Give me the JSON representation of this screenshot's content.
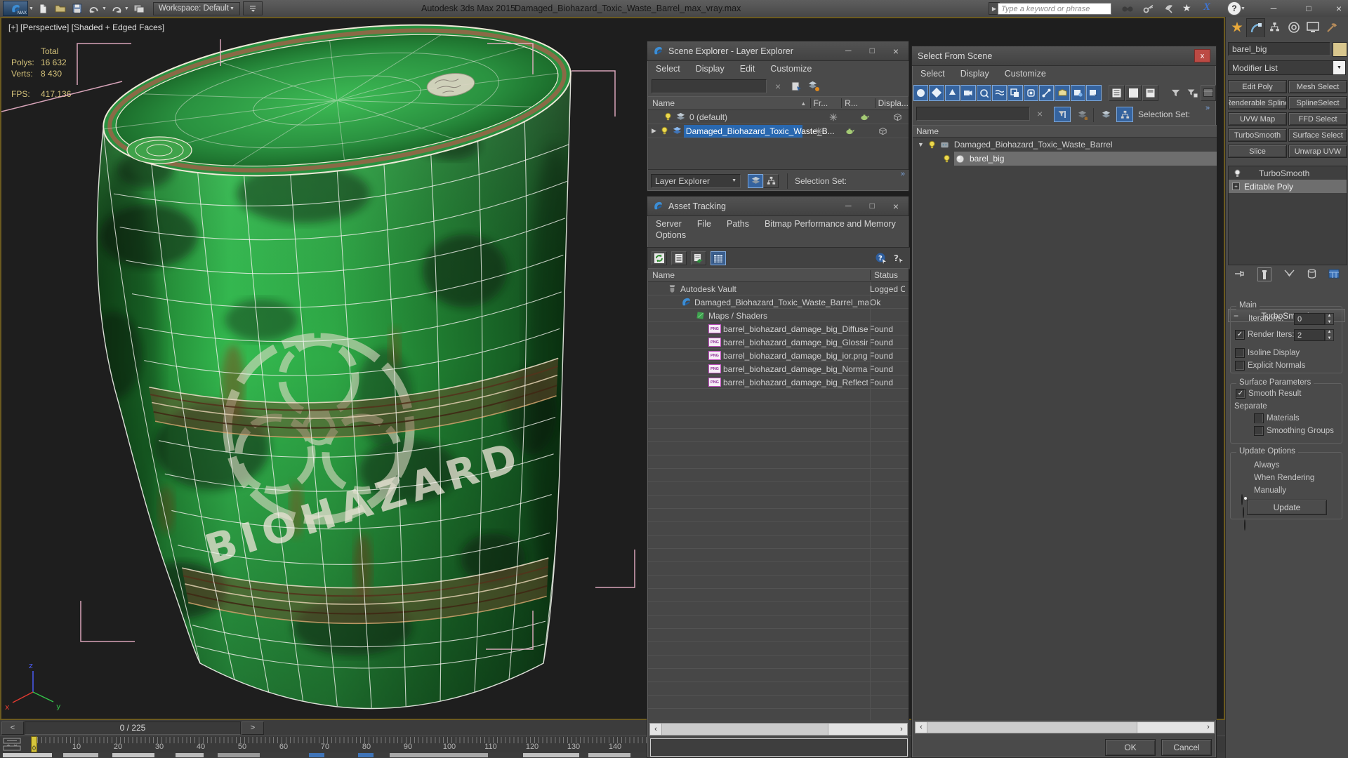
{
  "glyphs": {
    "min": "─",
    "max": "□",
    "close": "×",
    "close_x": "x",
    "sort_asc": "▲",
    "tri_right": "▶",
    "tri_down": "▼",
    "dd": "▼",
    "chevrons": "»",
    "left": "<",
    "right": ">",
    "sb_left": "‹",
    "sb_right": "›",
    "plus": "+",
    "minus": "−",
    "spin_up": "▲",
    "spin_dn": "▼",
    "question": "?",
    "star": "★",
    "ex": "X",
    "snow": "✳"
  },
  "titlebar": {
    "workspace": "Workspace: Default",
    "app_title": "Autodesk 3ds Max 2015",
    "file_name": "Damaged_Biohazard_Toxic_Waste_Barrel_max_vray.max",
    "search_placeholder": "Type a keyword or phrase",
    "logo_text": "MAX"
  },
  "viewport": {
    "label": "[+] [Perspective] [Shaded + Edged Faces]",
    "stats": {
      "total": "Total",
      "polys_label": "Polys:",
      "polys": "16 632",
      "verts_label": "Verts:",
      "verts": "8 430",
      "fps_label": "FPS:",
      "fps": "417,136"
    },
    "axis": {
      "x": "x",
      "y": "y",
      "z": "z"
    },
    "barrel": {
      "stencil_text": "BIOHAZARD"
    }
  },
  "timeline": {
    "counter": "0 / 225",
    "current_frame": "0",
    "tick_labels": [
      "10",
      "20",
      "30",
      "40",
      "50",
      "60",
      "70",
      "80",
      "90",
      "100",
      "110",
      "120",
      "130",
      "140"
    ]
  },
  "scene_explorer": {
    "title": "Scene Explorer - Layer Explorer",
    "menus": {
      "select": "Select",
      "display": "Display",
      "edit": "Edit",
      "customize": "Customize"
    },
    "columns": {
      "name": "Name",
      "frozen": "Fr...",
      "render": "R...",
      "display": "Displa..."
    },
    "rows": [
      {
        "label": "0 (default)"
      },
      {
        "label": "Damaged_Biohazard_Toxic_Waste_B..."
      }
    ],
    "mode": "Layer Explorer",
    "selection_set": "Selection Set:"
  },
  "asset_tracking": {
    "title": "Asset Tracking",
    "menus": {
      "server": "Server",
      "file": "File",
      "paths": "Paths",
      "bitmap": "Bitmap Performance and Memory",
      "options": "Options"
    },
    "columns": {
      "name": "Name",
      "status": "Status"
    },
    "png_label": "PNG",
    "rows": [
      {
        "name": "Autodesk Vault",
        "status": "Logged Out"
      },
      {
        "name": "Damaged_Biohazard_Toxic_Waste_Barrel_max...",
        "status": "Ok"
      },
      {
        "name": "Maps / Shaders",
        "status": ""
      },
      {
        "name": "barrel_biohazard_damage_big_Diffuse.p...",
        "status": "Found"
      },
      {
        "name": "barrel_biohazard_damage_big_Glossine...",
        "status": "Found"
      },
      {
        "name": "barrel_biohazard_damage_big_ior.png",
        "status": "Found"
      },
      {
        "name": "barrel_biohazard_damage_big_Normal....",
        "status": "Found"
      },
      {
        "name": "barrel_biohazard_damage_big_Reflectio...",
        "status": "Found"
      }
    ]
  },
  "select_from_scene": {
    "title": "Select From Scene",
    "menus": {
      "select": "Select",
      "display": "Display",
      "customize": "Customize"
    },
    "selection_set": "Selection Set:",
    "name_column": "Name",
    "tree": [
      {
        "label": "Damaged_Biohazard_Toxic_Waste_Barrel"
      },
      {
        "label": "barel_big"
      }
    ],
    "ok": "OK",
    "cancel": "Cancel"
  },
  "command_panel": {
    "object_name": "barel_big",
    "modifier_list": "Modifier List",
    "modifier_buttons": [
      "Edit Poly",
      "Mesh Select",
      "Renderable Spline",
      "SplineSelect",
      "UVW Map",
      "FFD Select",
      "TurboSmooth",
      "Surface Select",
      "Slice",
      "Unwrap UVW"
    ],
    "stack": {
      "turbosmooth": "TurboSmooth",
      "editable_poly": "Editable Poly"
    },
    "rollout": {
      "title": "TurboSmooth",
      "main": "Main",
      "iterations_label": "Iterations:",
      "iterations": "0",
      "render_iters_label": "Render Iters:",
      "render_iters": "2",
      "isoline": "Isoline Display",
      "explicit_normals": "Explicit Normals",
      "surface_params": "Surface Parameters",
      "smooth_result": "Smooth Result",
      "separate": "Separate",
      "materials": "Materials",
      "smoothing_groups": "Smoothing Groups",
      "update_options": "Update Options",
      "always": "Always",
      "when_rendering": "When Rendering",
      "manually": "Manually",
      "update": "Update"
    },
    "states": {
      "render_iters_checked": true,
      "smooth_result_checked": true,
      "always_on": true
    }
  },
  "colors": {
    "selection_blue": "#2968b0",
    "accent_blue": "#35639e",
    "close_red": "#bc4a44",
    "barrel_green": "#2ea946",
    "bracket_pink": "#ecb2ca"
  }
}
